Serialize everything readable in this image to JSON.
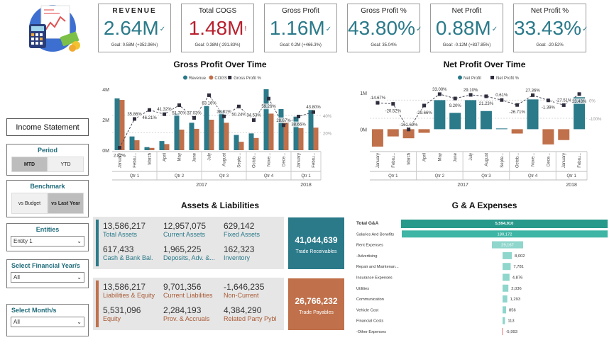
{
  "kpis": [
    {
      "title": "REVENUE",
      "value": "2.64M",
      "mark": "✓",
      "goal": "Goal: 0.58M (+352.96%)",
      "color": "teal"
    },
    {
      "title": "Total COGS",
      "value": "1.48M",
      "mark": "!",
      "goal": "Goal: 0.38M (-291.83%)",
      "color": "red"
    },
    {
      "title": "Gross Profit",
      "value": "1.16M",
      "mark": "✓",
      "goal": "Goal: 0.2M (+466.3%)",
      "color": "teal"
    },
    {
      "title": "Gross Profit %",
      "value": "43.80%",
      "mark": "✓",
      "goal": "Goal: 35.04%",
      "color": "teal"
    },
    {
      "title": "Net Profit",
      "value": "0.88M",
      "mark": "✓",
      "goal": "Goal: -0.12M (+837.85%)",
      "color": "teal"
    },
    {
      "title": "Net Profit %",
      "value": "33.43%",
      "mark": "✓",
      "goal": "Goal: -20.52%",
      "color": "teal"
    }
  ],
  "colors": {
    "teal": "#2b7a8a",
    "copper": "#c0704a",
    "dark": "#333333",
    "red": "#b8202e"
  },
  "sidebar": {
    "title": "Income Statement",
    "period": {
      "title": "Period",
      "options": [
        "MTD",
        "YTD"
      ],
      "selected": "MTD"
    },
    "benchmark": {
      "title": "Benchmark",
      "options": [
        "vs Budget",
        "vs Last Year"
      ],
      "selected": "vs Last Year"
    },
    "entities": {
      "title": "Entities",
      "value": "Entity 1"
    },
    "fiscal_year": {
      "title": "Select Financial Year/s",
      "value": "All"
    },
    "month": {
      "title": "Select Month/s",
      "value": "All"
    }
  },
  "sections": {
    "gross_title": "Gross Profit Over Time",
    "net_title": "Net Profit Over Time",
    "al_title": "Assets & Liabilities",
    "ga_title": "G & A Expenses"
  },
  "assets": {
    "cells": [
      {
        "value": "13,586,217",
        "label": "Total Assets"
      },
      {
        "value": "12,957,075",
        "label": "Current Assets"
      },
      {
        "value": "629,142",
        "label": "Fixed Assets"
      },
      {
        "value": "617,433",
        "label": "Cash & Bank Bal."
      },
      {
        "value": "1,965,225",
        "label": "Deposits, Adv. &..."
      },
      {
        "value": "162,323",
        "label": "Inventory"
      }
    ],
    "card": {
      "value": "41,044,639",
      "label": "Trade Receivables"
    }
  },
  "liabilities": {
    "cells": [
      {
        "value": "13,586,217",
        "label": "Liabilities & Equity"
      },
      {
        "value": "9,701,356",
        "label": "Current Liabilities"
      },
      {
        "value": "-1,646,235",
        "label": "Non-Current"
      },
      {
        "value": "5,531,096",
        "label": "Equity"
      },
      {
        "value": "2,284,193",
        "label": "Prov. & Accruals"
      },
      {
        "value": "4,384,290",
        "label": "Related Party Pybl"
      }
    ],
    "card": {
      "value": "26,766,232",
      "label": "Trade Payables"
    }
  },
  "chart_data": [
    {
      "type": "bar",
      "title": "Gross Profit Over Time",
      "legend": [
        "Revenue",
        "COGS",
        "Gross Profit %"
      ],
      "legend_position": "top",
      "categories": [
        "January",
        "Febru...",
        "March",
        "April",
        "May",
        "June",
        "July",
        "August",
        "Septe...",
        "Octob...",
        "Nove...",
        "Dece...",
        "January",
        "Febru..."
      ],
      "quarters": [
        {
          "label": "Qtr 1",
          "span": 3
        },
        {
          "label": "Qtr 2",
          "span": 3
        },
        {
          "label": "Qtr 3",
          "span": 3
        },
        {
          "label": "Qtr 4",
          "span": 3
        },
        {
          "label": "Qtr 1",
          "span": 2
        }
      ],
      "years": [
        {
          "label": "2017",
          "span": 12
        },
        {
          "label": "2018",
          "span": 2
        }
      ],
      "y_ticks": [
        "0M",
        "2M",
        "4M"
      ],
      "y2_ticks": [
        "20%",
        "40%"
      ],
      "ylim": [
        0,
        4
      ],
      "y2lim": [
        0,
        70
      ],
      "series": [
        {
          "name": "Revenue",
          "values": [
            3.4,
            0.9,
            0.2,
            0.6,
            2.45,
            1.8,
            2.9,
            2.6,
            1.0,
            1.1,
            4.0,
            2.7,
            2.2,
            2.64
          ]
        },
        {
          "name": "COGS",
          "values": [
            3.3,
            0.65,
            0.15,
            0.4,
            1.35,
            1.4,
            2.0,
            1.8,
            0.55,
            0.8,
            2.4,
            1.85,
            1.45,
            1.48
          ]
        },
        {
          "name": "Gross Profit %",
          "values": [
            2.82,
            35.86,
            46.21,
            41.32,
            51.7,
            37.03,
            63.16,
            38.81,
            50.24,
            34.53,
            59.26,
            28.67,
            38.66,
            43.8
          ]
        }
      ],
      "data_labels": [
        "2.82%",
        "35.86%",
        "46.21%",
        "41.32%",
        "51.70%",
        "37.03%",
        "63.16%",
        "38.81%",
        "50.24%",
        "34.53%",
        "59.26%",
        "28.67%",
        "38.66%",
        "43.80%"
      ]
    },
    {
      "type": "bar",
      "title": "Net Profit Over Time",
      "legend": [
        "Net Profit",
        "Net Profit %"
      ],
      "legend_position": "top",
      "categories": [
        "January",
        "Febru...",
        "March",
        "April",
        "May",
        "June",
        "July",
        "August",
        "Septe...",
        "Octob...",
        "Nove...",
        "Dece...",
        "January",
        "Febru..."
      ],
      "quarters": [
        {
          "label": "Qtr 1",
          "span": 3
        },
        {
          "label": "Qtr 2",
          "span": 3
        },
        {
          "label": "Qtr 3",
          "span": 3
        },
        {
          "label": "Qtr 4",
          "span": 3
        },
        {
          "label": "Qtr 1",
          "span": 2
        }
      ],
      "years": [
        {
          "label": "2017",
          "span": 12
        },
        {
          "label": "2018",
          "span": 2
        }
      ],
      "y_ticks": [
        "0M",
        "1M"
      ],
      "y2_ticks": [
        "-100%",
        "0%"
      ],
      "ylim": [
        -0.5,
        1.1
      ],
      "y2lim": [
        -260,
        60
      ],
      "series": [
        {
          "name": "Net Profit",
          "values": [
            -0.48,
            -0.2,
            -0.25,
            -0.1,
            0.8,
            0.45,
            0.8,
            0.5,
            0.02,
            -0.12,
            0.82,
            -0.42,
            -0.3,
            0.88
          ]
        },
        {
          "name": "Net Profit %",
          "values": [
            -14.67,
            -20.52,
            -161.69,
            -29.66,
            33.0,
            9.2,
            29.1,
            21.23,
            0.61,
            -26.71,
            27.36,
            -1.39,
            -27.51,
            33.43
          ]
        }
      ],
      "data_labels": [
        "-14.67%",
        "-20.52%",
        "-161.69%",
        "-29.66%",
        "33.00%",
        "9.20%",
        "29.10%",
        "21.23%",
        "0.61%",
        "-26.71%",
        "27.36%",
        "-1.39%",
        "-27.51%",
        "33.43%"
      ]
    },
    {
      "type": "bar",
      "title": "G & A Expenses",
      "orientation": "horizontal",
      "categories": [
        "Total G&A",
        "Salaries And Benefits",
        "Rent Expenses",
        "-Advertising",
        "Repair and Maintenan...",
        "Insurance Expenses",
        "Utilities",
        "Communication",
        "Vehicle Cost",
        "Financial Costs",
        "-Other Expenses"
      ],
      "values": [
        5594910,
        180172,
        29167,
        8002,
        7781,
        4876,
        2036,
        1293,
        856,
        113,
        -5993
      ],
      "value_labels": [
        "5,594,910",
        "180,172",
        "29,167",
        "8,002",
        "7,781",
        "4,876",
        "2,036",
        "1,293",
        "856",
        "113",
        "-5,993"
      ]
    }
  ]
}
